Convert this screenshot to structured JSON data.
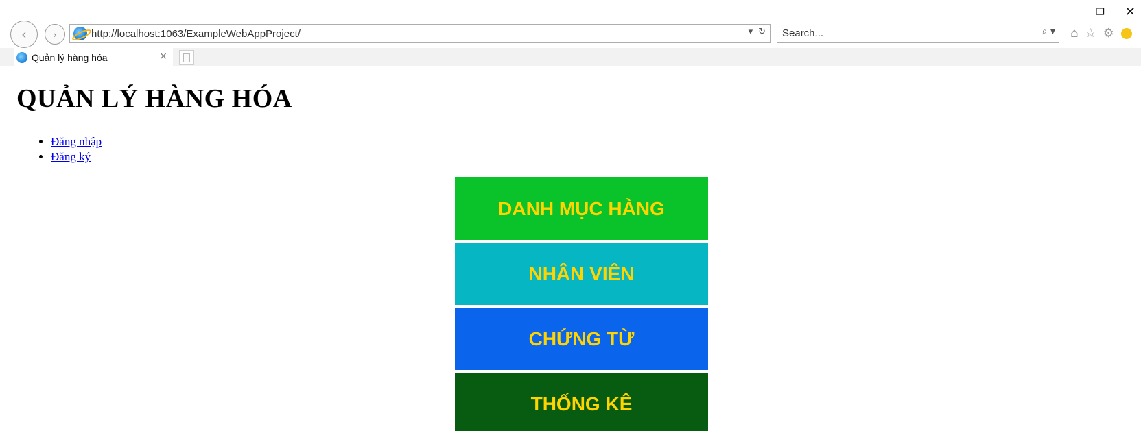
{
  "browser": {
    "url": "http://localhost:1063/ExampleWebAppProject/",
    "search_placeholder": "Search...",
    "tab_title": "Quản lý hàng hóa",
    "tab_close": "×",
    "window_restore": "❐",
    "window_close": "✕",
    "back_glyph": "‹",
    "forward_glyph": "›",
    "addr_dropdown": "▾",
    "addr_refresh": "↻",
    "search_icon": "⌕",
    "search_dropdown": "▾",
    "toolbar_home": "⌂",
    "toolbar_favorites": "☆",
    "toolbar_settings": "⚙"
  },
  "page": {
    "title": "QUẢN LÝ HÀNG HÓA",
    "links": [
      {
        "label": "Đăng nhập"
      },
      {
        "label": "Đăng ký"
      }
    ]
  },
  "menu": {
    "tiles": [
      {
        "label": "DANH MỤC HÀNG",
        "color": "#0ac22a"
      },
      {
        "label": "NHÂN VIÊN",
        "color": "#06b6c3"
      },
      {
        "label": "CHỨNG TỪ",
        "color": "#0a64ec"
      },
      {
        "label": "THỐNG KÊ",
        "color": "#075c12"
      }
    ],
    "text_color": "#ffd400"
  }
}
